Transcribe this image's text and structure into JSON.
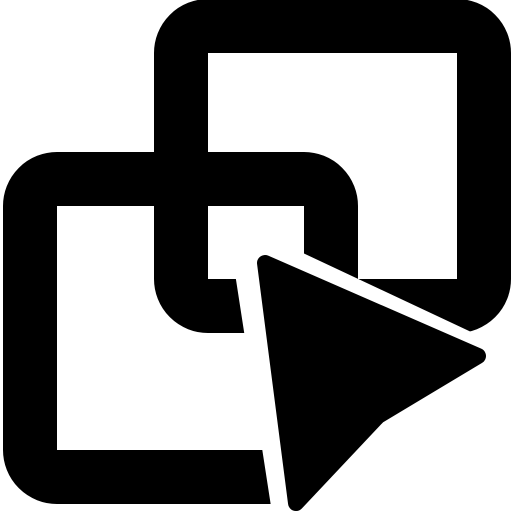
{
  "icon": {
    "name": "select-overlapping-windows-icon",
    "colors": {
      "foreground": "#000000",
      "background": "#ffffff"
    },
    "parts": [
      "back-window-frame-icon",
      "front-window-frame-icon",
      "cursor-arrow-icon"
    ]
  }
}
